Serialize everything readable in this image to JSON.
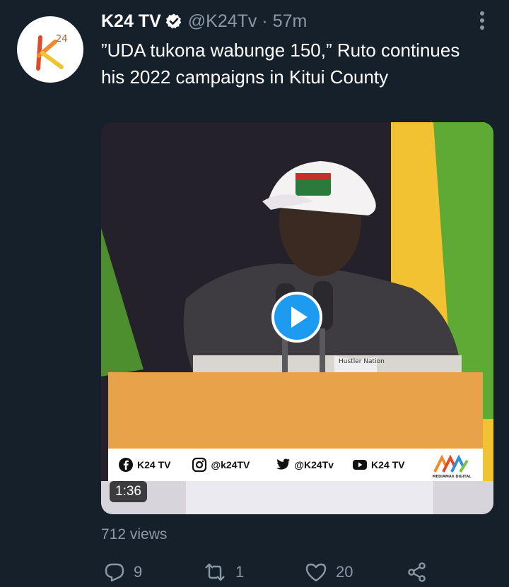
{
  "tweet": {
    "author_name": "K24 TV",
    "handle": "@K24Tv",
    "separator": "·",
    "time": "57m",
    "text": "”UDA tukona wabunge 150,” Ruto continues his 2022 campaigns in Kitui County",
    "views": "712 views",
    "avatar_icon": "k24-logo",
    "verified_icon": "verified-badge-icon",
    "more_icon": "more-vertical-icon"
  },
  "video": {
    "duration": "1:36",
    "play_icon": "play-icon",
    "socials": [
      {
        "icon": "facebook-icon",
        "label": "K24 TV"
      },
      {
        "icon": "instagram-icon",
        "label": "@k24TV"
      },
      {
        "icon": "twitter-icon",
        "label": "@K24Tv"
      },
      {
        "icon": "youtube-icon",
        "label": "K24 TV"
      }
    ],
    "mediamax_logo": "MEDIAMAX DIGITAL",
    "shirt_text": "Hustler Nation"
  },
  "actions": {
    "replies": "9",
    "retweets": "1",
    "likes": "20"
  },
  "colors": {
    "background": "#15202b",
    "text": "#ffffff",
    "secondary": "#8b98a5",
    "accent": "#1d9bf0",
    "banner": "#e8a24a"
  }
}
